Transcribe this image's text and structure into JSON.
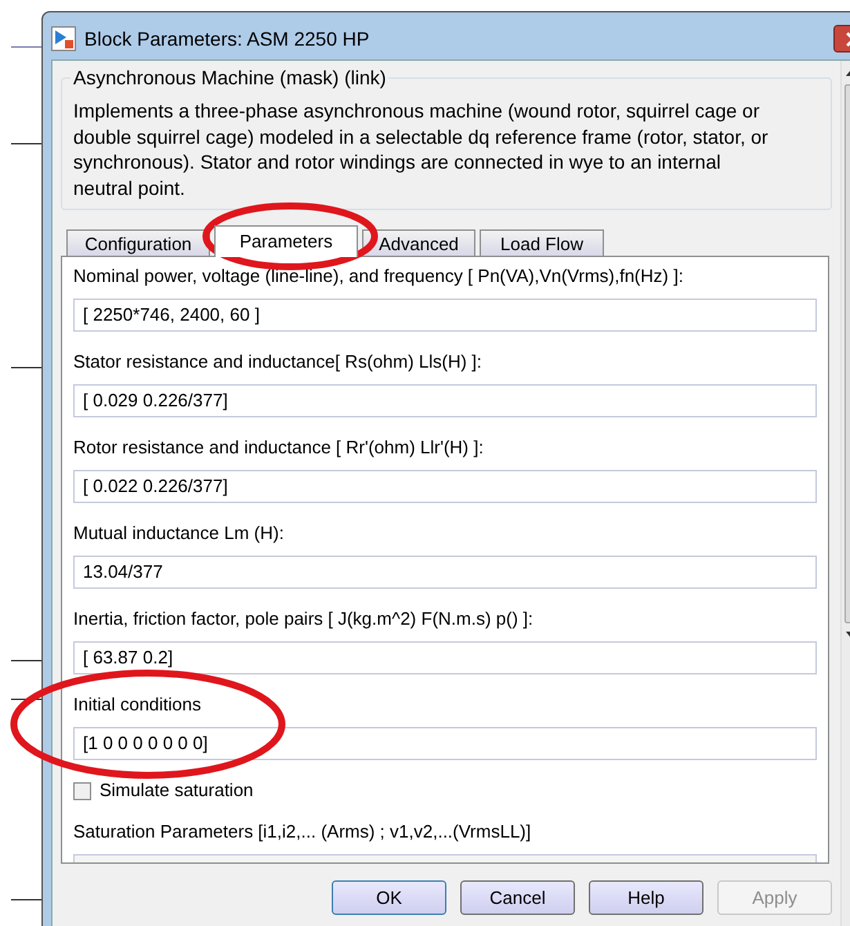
{
  "window": {
    "title": "Block Parameters: ASM 2250 HP"
  },
  "group": {
    "title": "Asynchronous Machine (mask) (link)",
    "description": "Implements a three-phase asynchronous machine (wound rotor, squirrel cage or double squirrel cage) modeled in a selectable dq reference frame (rotor, stator, or synchronous). Stator and rotor windings are connected in wye to an internal neutral point."
  },
  "tabs": [
    {
      "label": "Configuration",
      "selected": false
    },
    {
      "label": "Parameters",
      "selected": true
    },
    {
      "label": "Advanced",
      "selected": false
    },
    {
      "label": "Load Flow",
      "selected": false
    }
  ],
  "fields": [
    {
      "kind": "text",
      "label": "Nominal power, voltage (line-line), and frequency [ Pn(VA),Vn(Vrms),fn(Hz) ]:",
      "value": "[ 2250*746, 2400, 60 ]"
    },
    {
      "kind": "text",
      "label": "Stator resistance and inductance[ Rs(ohm)  Lls(H) ]:",
      "value": "[ 0.029 0.226/377]"
    },
    {
      "kind": "text",
      "label": "Rotor resistance and inductance [ Rr'(ohm)  Llr'(H) ]:",
      "value": "[ 0.022 0.226/377]"
    },
    {
      "kind": "text",
      "label": "Mutual inductance Lm (H):",
      "value": "13.04/377"
    },
    {
      "kind": "text",
      "label": "Inertia, friction factor, pole pairs [ J(kg.m^2)  F(N.m.s)   p() ]:",
      "value": "[ 63.87 0.2]"
    },
    {
      "kind": "text",
      "label": "Initial conditions",
      "value": "[1 0 0 0 0 0 0 0]"
    },
    {
      "kind": "checkbox",
      "label": "Simulate saturation",
      "checked": false
    },
    {
      "kind": "text",
      "label": "Saturation Parameters [i1,i2,... (Arms) ; v1,v2,...(VrmsLL)]",
      "disabled": true
    }
  ],
  "buttons": [
    {
      "label": "OK",
      "disabled": false
    },
    {
      "label": "Cancel",
      "disabled": false
    },
    {
      "label": "Help",
      "disabled": false
    },
    {
      "label": "Apply",
      "disabled": true
    }
  ]
}
